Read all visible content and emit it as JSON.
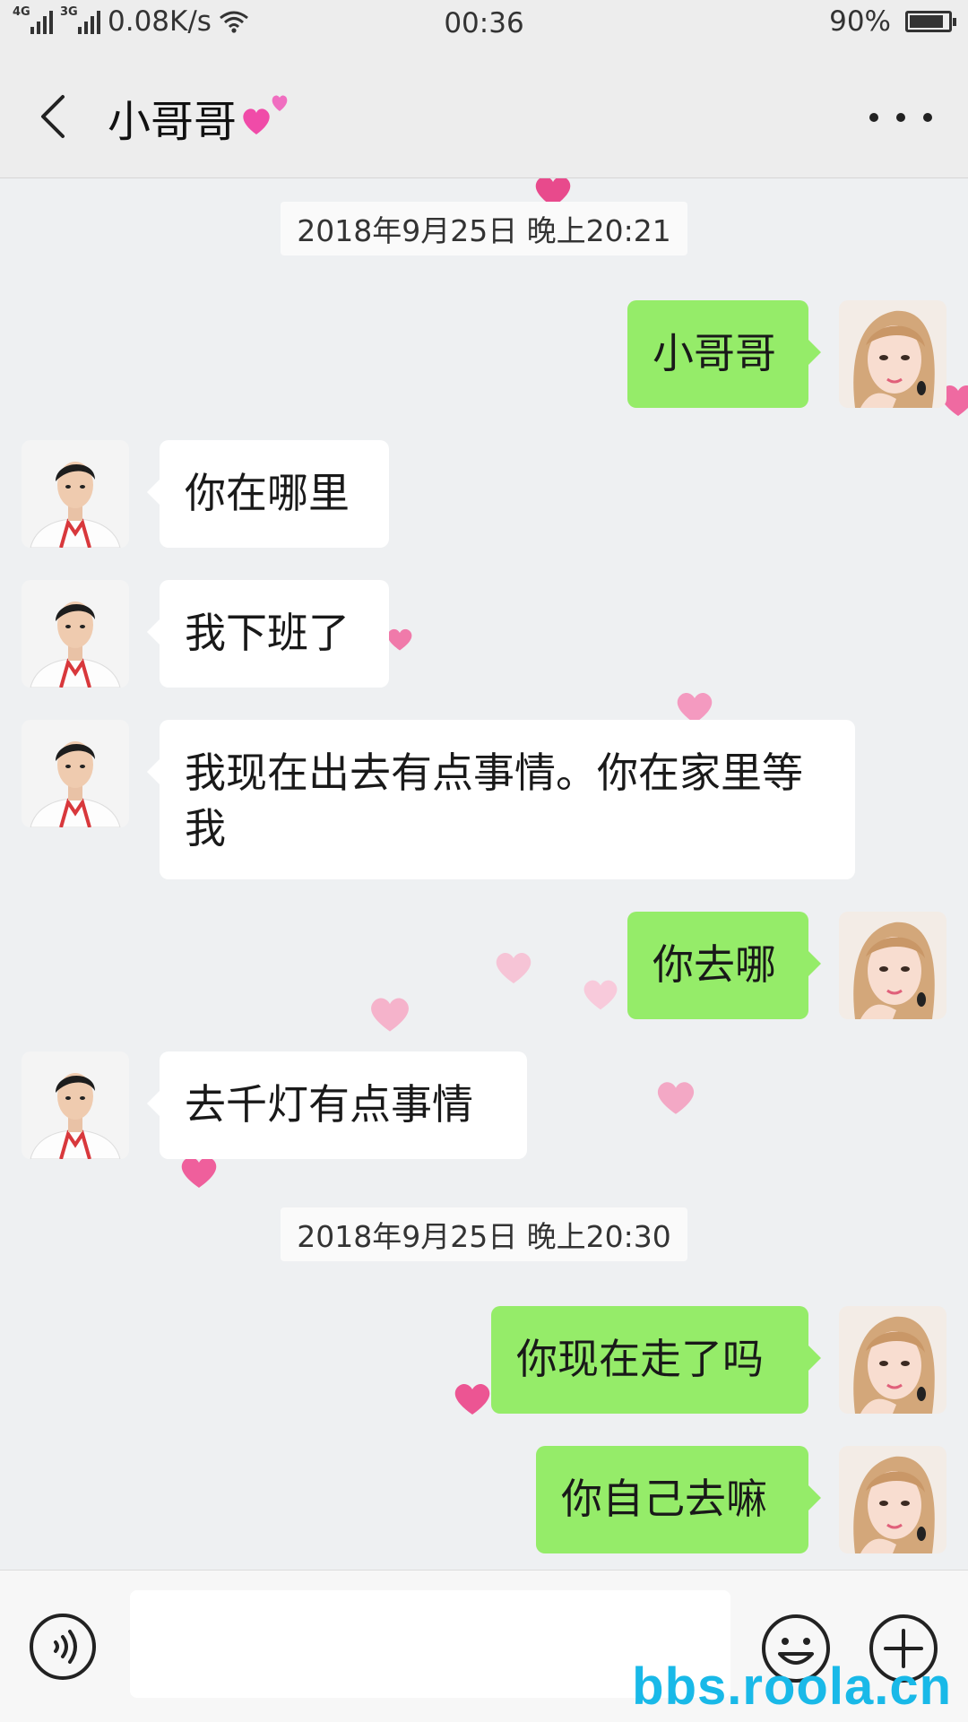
{
  "status_bar": {
    "network_1": "4G",
    "network_2": "3G",
    "speed": "0.08K/s",
    "time": "00:36",
    "battery": "90%",
    "battery_level": 0.9
  },
  "header": {
    "title": "小哥哥",
    "title_emoji": "two-hearts-emoji"
  },
  "messages": [
    {
      "type": "time",
      "text": "2018年9月25日 晚上20:21"
    },
    {
      "type": "out",
      "text": "小哥哥"
    },
    {
      "type": "in",
      "text": "你在哪里"
    },
    {
      "type": "in",
      "text": "我下班了"
    },
    {
      "type": "in",
      "text": "我现在出去有点事情。你在家里等我"
    },
    {
      "type": "out",
      "text": "你去哪"
    },
    {
      "type": "in",
      "text": "去千灯有点事情"
    },
    {
      "type": "time",
      "text": "2018年9月25日 晚上20:30"
    },
    {
      "type": "out",
      "text": "你现在走了吗"
    },
    {
      "type": "out",
      "text": "你自己去嘛"
    }
  ],
  "input_bar": {
    "placeholder": ""
  },
  "watermark": "bbs.roola.cn",
  "colors": {
    "outgoing_bubble": "#95ec69",
    "incoming_bubble": "#ffffff",
    "chat_background": "#eef0f2",
    "watermark": "#19b9e8"
  }
}
